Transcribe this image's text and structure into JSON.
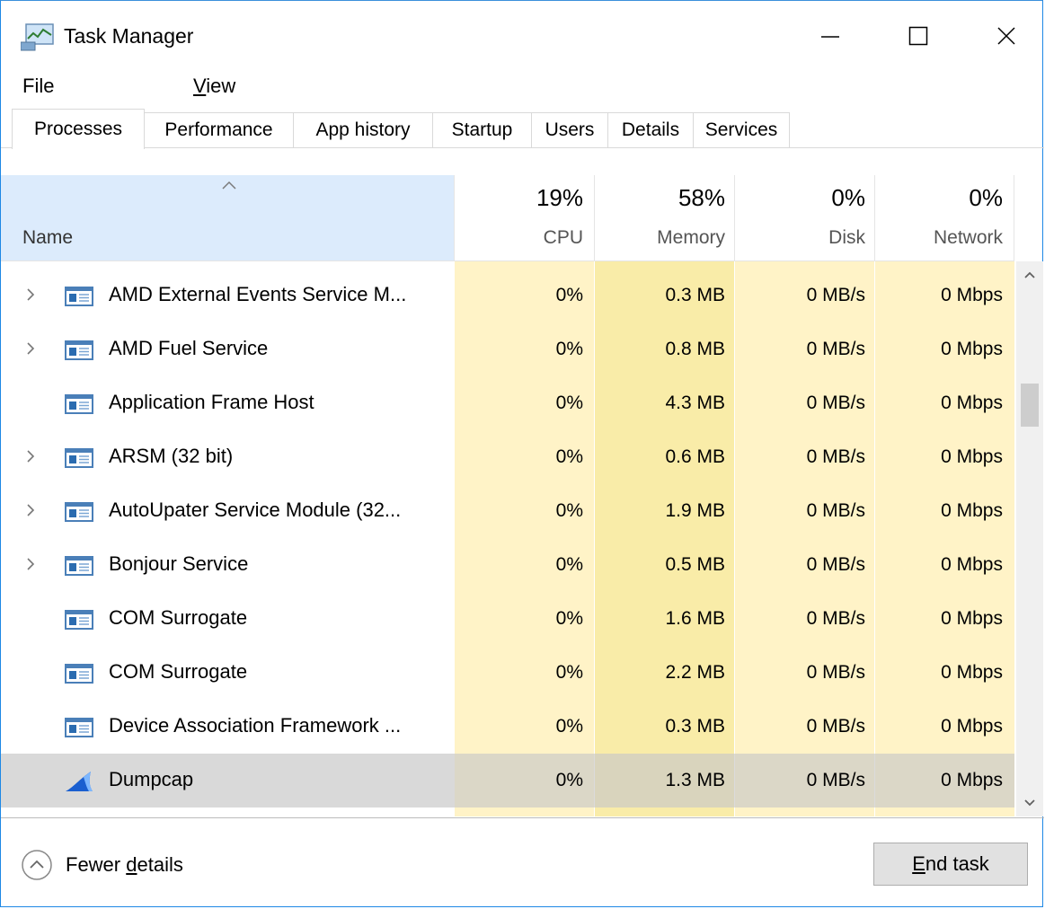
{
  "window": {
    "title": "Task Manager",
    "icons": {
      "app": "task-manager-icon",
      "minimize": "minimize-icon",
      "maximize": "maximize-icon",
      "close": "close-icon"
    }
  },
  "menu": {
    "file": "File",
    "view_mnemonic": "V",
    "view_rest": "iew"
  },
  "tabs": [
    "Processes",
    "Performance",
    "App history",
    "Startup",
    "Users",
    "Details",
    "Services"
  ],
  "active_tab": "Processes",
  "header": {
    "name": "Name",
    "cpu_pct": "19%",
    "cpu": "CPU",
    "memory_pct": "58%",
    "memory": "Memory",
    "disk_pct": "0%",
    "disk": "Disk",
    "network_pct": "0%",
    "network": "Network"
  },
  "processes": [
    {
      "name": "AMD External Events Service M...",
      "expandable": true,
      "icon": "window-app-icon",
      "cpu": "0%",
      "memory": "0.3 MB",
      "disk": "0 MB/s",
      "network": "0 Mbps"
    },
    {
      "name": "AMD Fuel Service",
      "expandable": true,
      "icon": "window-app-icon",
      "cpu": "0%",
      "memory": "0.8 MB",
      "disk": "0 MB/s",
      "network": "0 Mbps"
    },
    {
      "name": "Application Frame Host",
      "expandable": false,
      "icon": "window-app-icon",
      "cpu": "0%",
      "memory": "4.3 MB",
      "disk": "0 MB/s",
      "network": "0 Mbps"
    },
    {
      "name": "ARSM (32 bit)",
      "expandable": true,
      "icon": "window-app-icon",
      "cpu": "0%",
      "memory": "0.6 MB",
      "disk": "0 MB/s",
      "network": "0 Mbps"
    },
    {
      "name": "AutoUpater Service Module (32...",
      "expandable": true,
      "icon": "window-app-icon",
      "cpu": "0%",
      "memory": "1.9 MB",
      "disk": "0 MB/s",
      "network": "0 Mbps"
    },
    {
      "name": "Bonjour Service",
      "expandable": true,
      "icon": "window-app-icon",
      "cpu": "0%",
      "memory": "0.5 MB",
      "disk": "0 MB/s",
      "network": "0 Mbps"
    },
    {
      "name": "COM Surrogate",
      "expandable": false,
      "icon": "window-app-icon",
      "cpu": "0%",
      "memory": "1.6 MB",
      "disk": "0 MB/s",
      "network": "0 Mbps"
    },
    {
      "name": "COM Surrogate",
      "expandable": false,
      "icon": "window-app-icon",
      "cpu": "0%",
      "memory": "2.2 MB",
      "disk": "0 MB/s",
      "network": "0 Mbps"
    },
    {
      "name": "Device Association Framework ...",
      "expandable": false,
      "icon": "window-app-icon",
      "cpu": "0%",
      "memory": "0.3 MB",
      "disk": "0 MB/s",
      "network": "0 Mbps"
    },
    {
      "name": "Dumpcap",
      "expandable": false,
      "icon": "shark-fin-icon",
      "selected": true,
      "cpu": "0%",
      "memory": "1.3 MB",
      "disk": "0 MB/s",
      "network": "0 Mbps"
    }
  ],
  "footer": {
    "fewer_prefix": "Fewer ",
    "fewer_mnemonic": "d",
    "fewer_rest": "etails",
    "end_mnemonic": "E",
    "end_rest": "nd task"
  },
  "colors": {
    "header_selected": "#dcebfc",
    "heat_low": "#fff3c7",
    "heat_mid": "#f9eca8",
    "window_border": "#1e88e5"
  }
}
